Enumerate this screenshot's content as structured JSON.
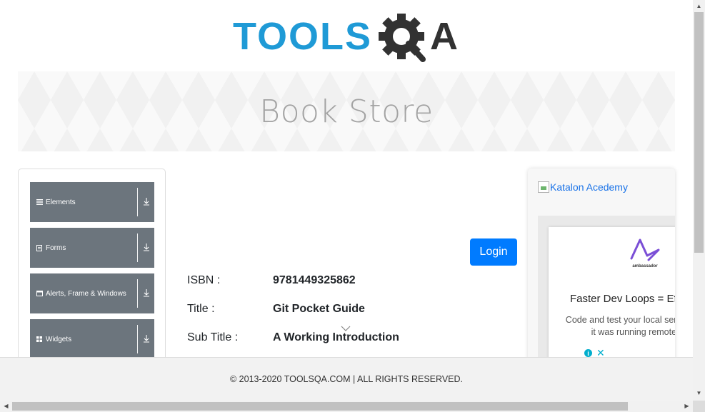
{
  "logo": {
    "text_tools": "TOOLS",
    "text_qa": "QA",
    "brand_blue": "#1f9ad6",
    "brand_dark": "#323232"
  },
  "banner": {
    "title": "Book Store"
  },
  "left_nav": {
    "groups": [
      {
        "label": "Elements",
        "icon": "hamburger-icon"
      },
      {
        "label": "Forms",
        "icon": "document-icon"
      },
      {
        "label": "Alerts, Frame & Windows",
        "icon": "window-icon"
      },
      {
        "label": "Widgets",
        "icon": "grid-icon"
      }
    ]
  },
  "main": {
    "login_label": "Login",
    "book": {
      "isbn_label": "ISBN :",
      "isbn_value": "9781449325862",
      "title_label": "Title :",
      "title_value": "Git Pocket Guide",
      "subtitle_label": "Sub Title :",
      "subtitle_value": "A Working Introduction"
    }
  },
  "right_ad": {
    "link_text": "Katalon Acedemy",
    "ad_brand": "ambassador",
    "headline": "Faster Dev Loops = Effic",
    "body": "Code and test your local servic time as if it was running remote cloud"
  },
  "footer": {
    "text": "© 2013-2020 TOOLSQA.COM | ALL RIGHTS RESERVED."
  },
  "colors": {
    "nav_bg": "#6c757d",
    "login_bg": "#007bff",
    "footer_bg": "#f2f2f2"
  }
}
